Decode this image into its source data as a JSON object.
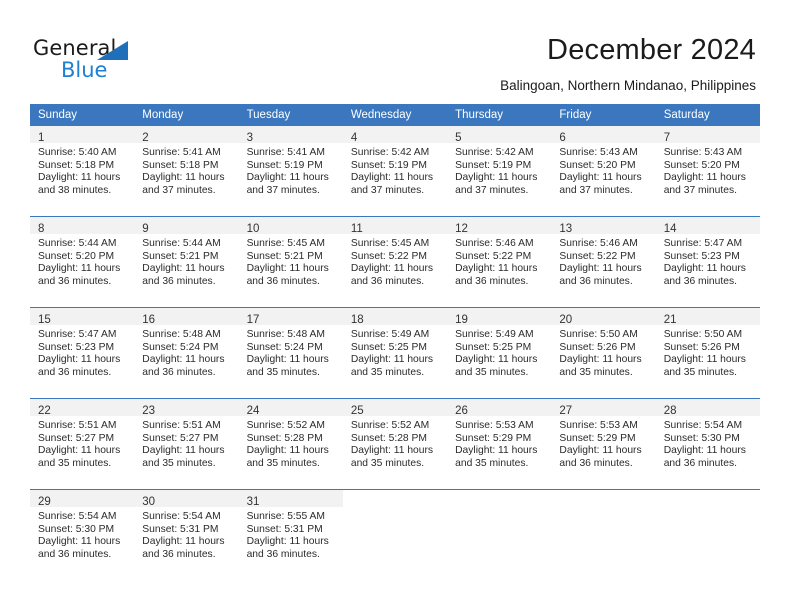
{
  "brand": {
    "name_top": "General",
    "name_bottom": "Blue",
    "triangle_icon": "triangle-icon",
    "accent_color": "#1f7fd0"
  },
  "header": {
    "title": "December 2024",
    "subtitle": "Balingoan, Northern Mindanao, Philippines"
  },
  "calendar": {
    "header_bg": "#3a77bf",
    "daynum_bg": "#f2f2f2",
    "weekday_headers": [
      "Sunday",
      "Monday",
      "Tuesday",
      "Wednesday",
      "Thursday",
      "Friday",
      "Saturday"
    ],
    "weeks": [
      [
        {
          "day": "1",
          "sunrise": "Sunrise: 5:40 AM",
          "sunset": "Sunset: 5:18 PM",
          "daylight1": "Daylight: 11 hours",
          "daylight2": "and 38 minutes."
        },
        {
          "day": "2",
          "sunrise": "Sunrise: 5:41 AM",
          "sunset": "Sunset: 5:18 PM",
          "daylight1": "Daylight: 11 hours",
          "daylight2": "and 37 minutes."
        },
        {
          "day": "3",
          "sunrise": "Sunrise: 5:41 AM",
          "sunset": "Sunset: 5:19 PM",
          "daylight1": "Daylight: 11 hours",
          "daylight2": "and 37 minutes."
        },
        {
          "day": "4",
          "sunrise": "Sunrise: 5:42 AM",
          "sunset": "Sunset: 5:19 PM",
          "daylight1": "Daylight: 11 hours",
          "daylight2": "and 37 minutes."
        },
        {
          "day": "5",
          "sunrise": "Sunrise: 5:42 AM",
          "sunset": "Sunset: 5:19 PM",
          "daylight1": "Daylight: 11 hours",
          "daylight2": "and 37 minutes."
        },
        {
          "day": "6",
          "sunrise": "Sunrise: 5:43 AM",
          "sunset": "Sunset: 5:20 PM",
          "daylight1": "Daylight: 11 hours",
          "daylight2": "and 37 minutes."
        },
        {
          "day": "7",
          "sunrise": "Sunrise: 5:43 AM",
          "sunset": "Sunset: 5:20 PM",
          "daylight1": "Daylight: 11 hours",
          "daylight2": "and 37 minutes."
        }
      ],
      [
        {
          "day": "8",
          "sunrise": "Sunrise: 5:44 AM",
          "sunset": "Sunset: 5:20 PM",
          "daylight1": "Daylight: 11 hours",
          "daylight2": "and 36 minutes."
        },
        {
          "day": "9",
          "sunrise": "Sunrise: 5:44 AM",
          "sunset": "Sunset: 5:21 PM",
          "daylight1": "Daylight: 11 hours",
          "daylight2": "and 36 minutes."
        },
        {
          "day": "10",
          "sunrise": "Sunrise: 5:45 AM",
          "sunset": "Sunset: 5:21 PM",
          "daylight1": "Daylight: 11 hours",
          "daylight2": "and 36 minutes."
        },
        {
          "day": "11",
          "sunrise": "Sunrise: 5:45 AM",
          "sunset": "Sunset: 5:22 PM",
          "daylight1": "Daylight: 11 hours",
          "daylight2": "and 36 minutes."
        },
        {
          "day": "12",
          "sunrise": "Sunrise: 5:46 AM",
          "sunset": "Sunset: 5:22 PM",
          "daylight1": "Daylight: 11 hours",
          "daylight2": "and 36 minutes."
        },
        {
          "day": "13",
          "sunrise": "Sunrise: 5:46 AM",
          "sunset": "Sunset: 5:22 PM",
          "daylight1": "Daylight: 11 hours",
          "daylight2": "and 36 minutes."
        },
        {
          "day": "14",
          "sunrise": "Sunrise: 5:47 AM",
          "sunset": "Sunset: 5:23 PM",
          "daylight1": "Daylight: 11 hours",
          "daylight2": "and 36 minutes."
        }
      ],
      [
        {
          "day": "15",
          "sunrise": "Sunrise: 5:47 AM",
          "sunset": "Sunset: 5:23 PM",
          "daylight1": "Daylight: 11 hours",
          "daylight2": "and 36 minutes."
        },
        {
          "day": "16",
          "sunrise": "Sunrise: 5:48 AM",
          "sunset": "Sunset: 5:24 PM",
          "daylight1": "Daylight: 11 hours",
          "daylight2": "and 36 minutes."
        },
        {
          "day": "17",
          "sunrise": "Sunrise: 5:48 AM",
          "sunset": "Sunset: 5:24 PM",
          "daylight1": "Daylight: 11 hours",
          "daylight2": "and 35 minutes."
        },
        {
          "day": "18",
          "sunrise": "Sunrise: 5:49 AM",
          "sunset": "Sunset: 5:25 PM",
          "daylight1": "Daylight: 11 hours",
          "daylight2": "and 35 minutes."
        },
        {
          "day": "19",
          "sunrise": "Sunrise: 5:49 AM",
          "sunset": "Sunset: 5:25 PM",
          "daylight1": "Daylight: 11 hours",
          "daylight2": "and 35 minutes."
        },
        {
          "day": "20",
          "sunrise": "Sunrise: 5:50 AM",
          "sunset": "Sunset: 5:26 PM",
          "daylight1": "Daylight: 11 hours",
          "daylight2": "and 35 minutes."
        },
        {
          "day": "21",
          "sunrise": "Sunrise: 5:50 AM",
          "sunset": "Sunset: 5:26 PM",
          "daylight1": "Daylight: 11 hours",
          "daylight2": "and 35 minutes."
        }
      ],
      [
        {
          "day": "22",
          "sunrise": "Sunrise: 5:51 AM",
          "sunset": "Sunset: 5:27 PM",
          "daylight1": "Daylight: 11 hours",
          "daylight2": "and 35 minutes."
        },
        {
          "day": "23",
          "sunrise": "Sunrise: 5:51 AM",
          "sunset": "Sunset: 5:27 PM",
          "daylight1": "Daylight: 11 hours",
          "daylight2": "and 35 minutes."
        },
        {
          "day": "24",
          "sunrise": "Sunrise: 5:52 AM",
          "sunset": "Sunset: 5:28 PM",
          "daylight1": "Daylight: 11 hours",
          "daylight2": "and 35 minutes."
        },
        {
          "day": "25",
          "sunrise": "Sunrise: 5:52 AM",
          "sunset": "Sunset: 5:28 PM",
          "daylight1": "Daylight: 11 hours",
          "daylight2": "and 35 minutes."
        },
        {
          "day": "26",
          "sunrise": "Sunrise: 5:53 AM",
          "sunset": "Sunset: 5:29 PM",
          "daylight1": "Daylight: 11 hours",
          "daylight2": "and 35 minutes."
        },
        {
          "day": "27",
          "sunrise": "Sunrise: 5:53 AM",
          "sunset": "Sunset: 5:29 PM",
          "daylight1": "Daylight: 11 hours",
          "daylight2": "and 36 minutes."
        },
        {
          "day": "28",
          "sunrise": "Sunrise: 5:54 AM",
          "sunset": "Sunset: 5:30 PM",
          "daylight1": "Daylight: 11 hours",
          "daylight2": "and 36 minutes."
        }
      ],
      [
        {
          "day": "29",
          "sunrise": "Sunrise: 5:54 AM",
          "sunset": "Sunset: 5:30 PM",
          "daylight1": "Daylight: 11 hours",
          "daylight2": "and 36 minutes."
        },
        {
          "day": "30",
          "sunrise": "Sunrise: 5:54 AM",
          "sunset": "Sunset: 5:31 PM",
          "daylight1": "Daylight: 11 hours",
          "daylight2": "and 36 minutes."
        },
        {
          "day": "31",
          "sunrise": "Sunrise: 5:55 AM",
          "sunset": "Sunset: 5:31 PM",
          "daylight1": "Daylight: 11 hours",
          "daylight2": "and 36 minutes."
        },
        {
          "day": "",
          "sunrise": "",
          "sunset": "",
          "daylight1": "",
          "daylight2": ""
        },
        {
          "day": "",
          "sunrise": "",
          "sunset": "",
          "daylight1": "",
          "daylight2": ""
        },
        {
          "day": "",
          "sunrise": "",
          "sunset": "",
          "daylight1": "",
          "daylight2": ""
        },
        {
          "day": "",
          "sunrise": "",
          "sunset": "",
          "daylight1": "",
          "daylight2": ""
        }
      ]
    ]
  }
}
